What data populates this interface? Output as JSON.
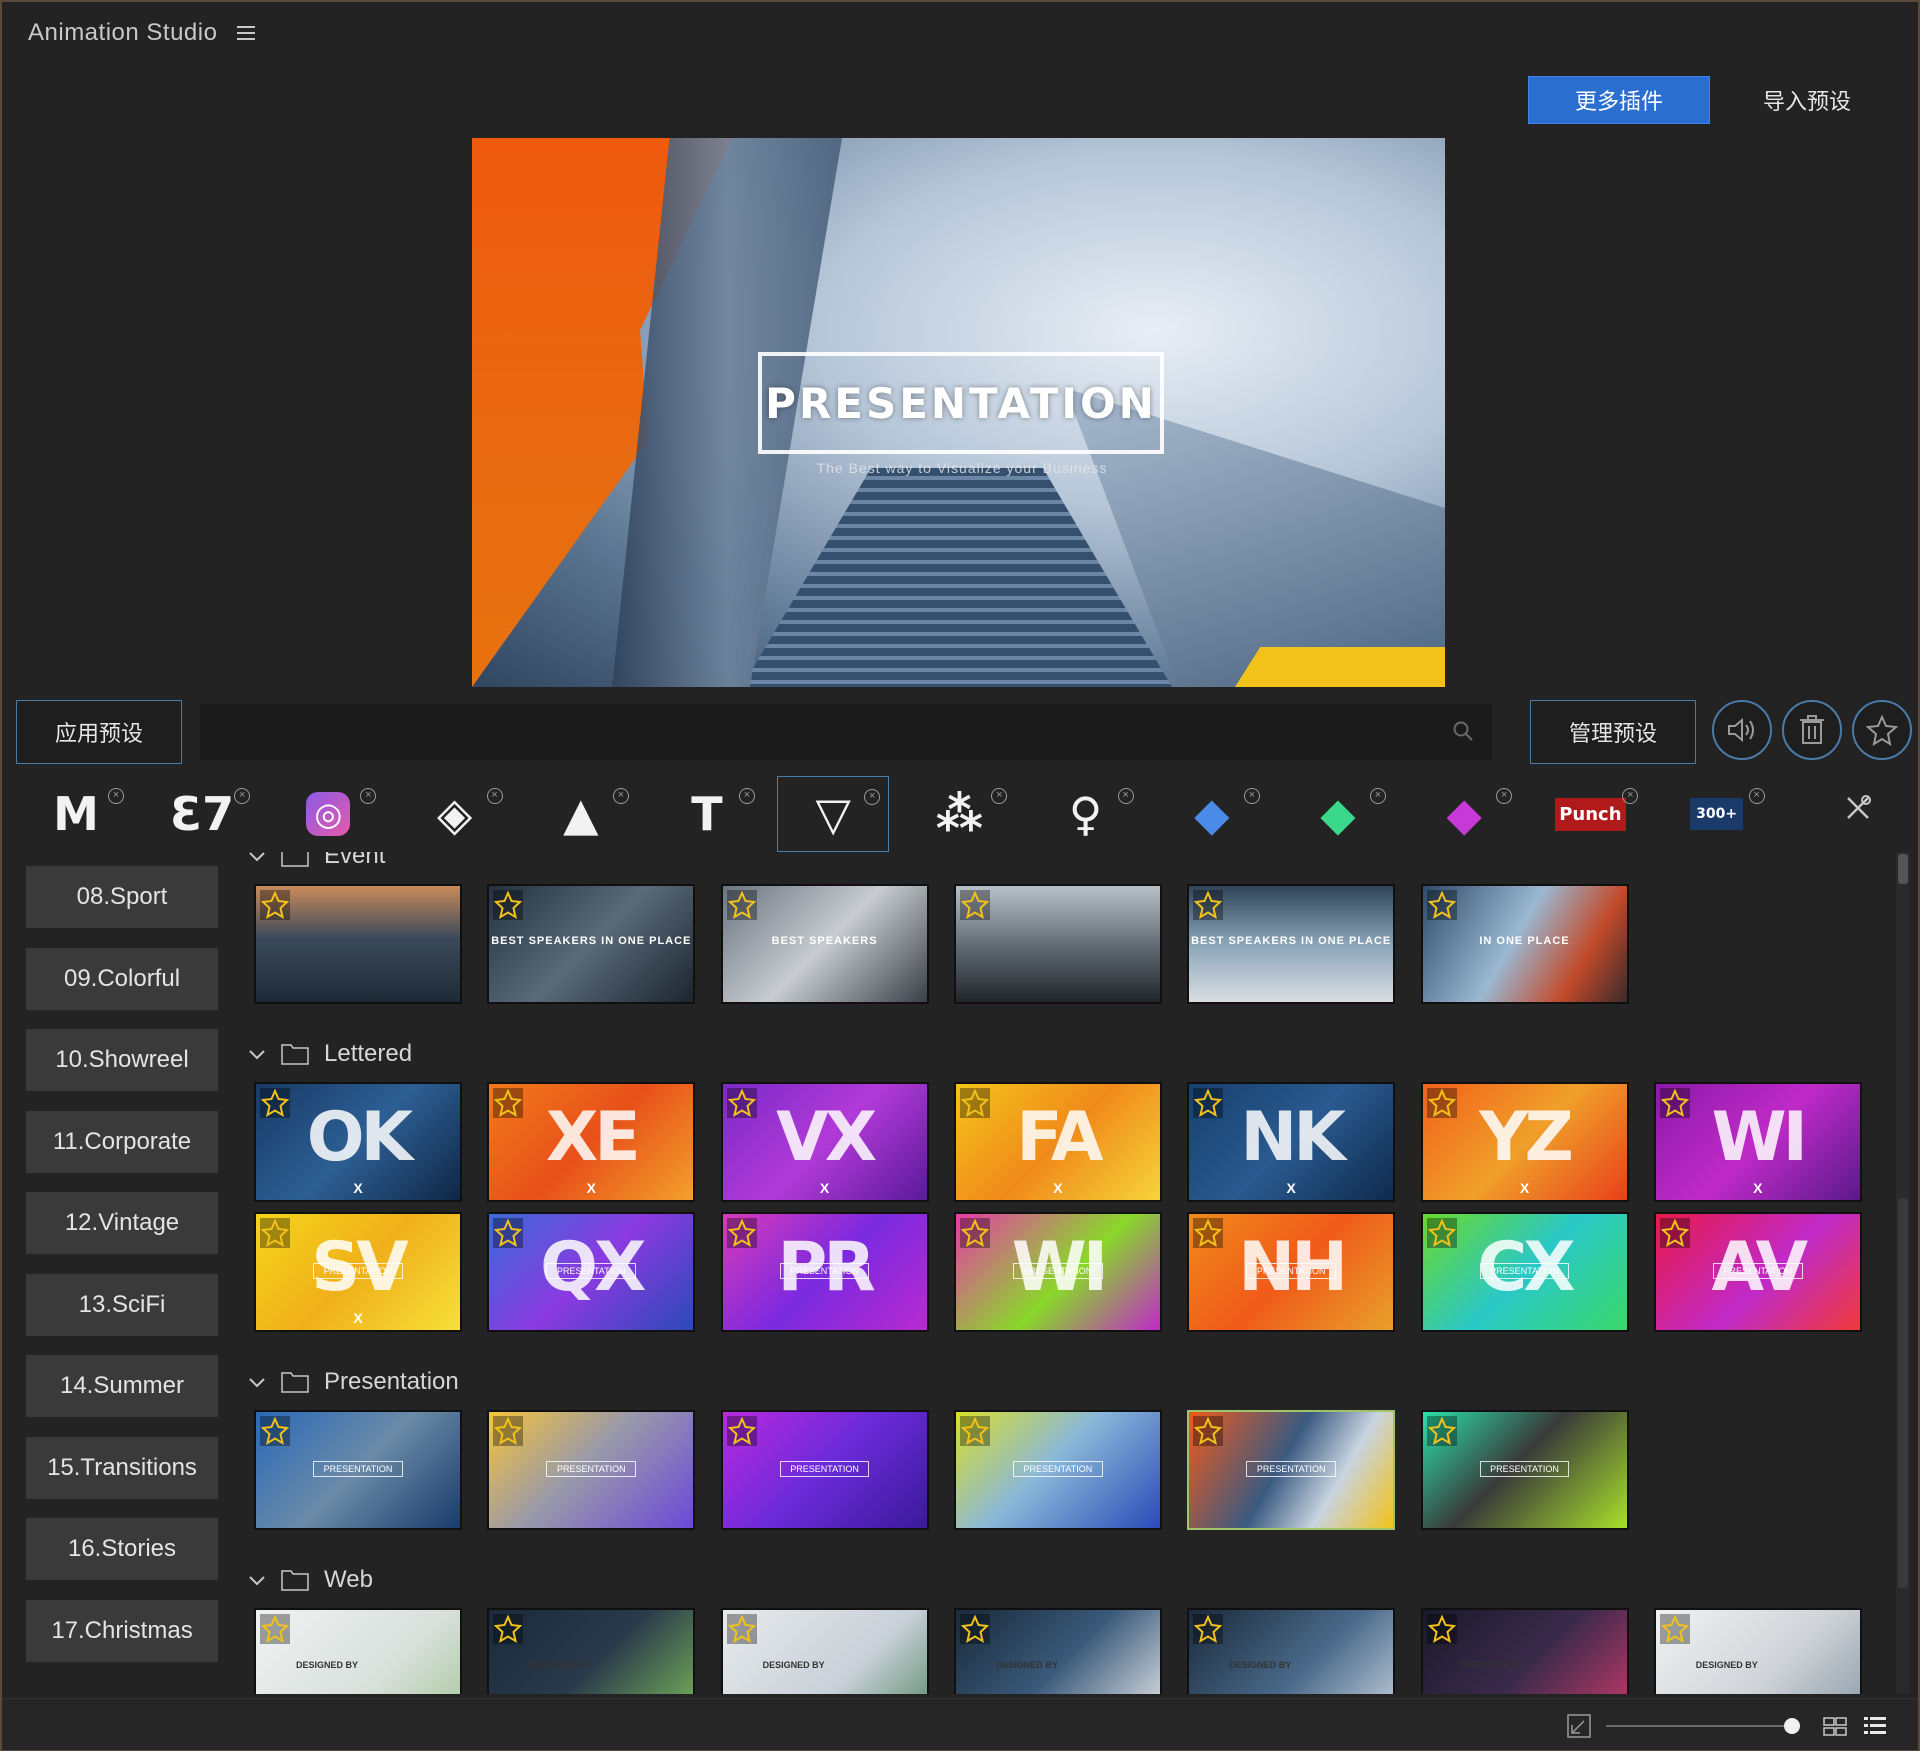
{
  "app": {
    "title": "Animation Studio"
  },
  "header": {
    "more_plugins": "更多插件",
    "import_presets": "导入预设"
  },
  "preview": {
    "title": "PRESENTATION",
    "subtitle": "The Best way to Visualize your Business"
  },
  "toolbar": {
    "apply_label": "应用预设",
    "manage_label": "管理预设",
    "search_value": "",
    "search_placeholder": ""
  },
  "plugins": [
    {
      "icon": "m-logo-icon",
      "glyph": "M",
      "style": "white"
    },
    {
      "icon": "e7-logo-icon",
      "glyph": "Ɛ7",
      "style": "white"
    },
    {
      "icon": "instagram-logo-icon",
      "glyph": "◎",
      "style": "insta"
    },
    {
      "icon": "layers-logo-icon",
      "glyph": "◈",
      "style": "white"
    },
    {
      "icon": "a-logo-icon",
      "glyph": "▲",
      "style": "white"
    },
    {
      "icon": "t-logo-icon",
      "glyph": "T",
      "style": "white"
    },
    {
      "icon": "v-logo-icon",
      "glyph": "▽",
      "style": "white",
      "active": true
    },
    {
      "icon": "molecule-logo-icon",
      "glyph": "⁂",
      "style": "white"
    },
    {
      "icon": "q-logo-icon",
      "glyph": "♀",
      "style": "white"
    },
    {
      "icon": "blue-cube-logo-icon",
      "glyph": "◆",
      "style": "blue"
    },
    {
      "icon": "green-cube-logo-icon",
      "glyph": "◆",
      "style": "green"
    },
    {
      "icon": "pink-cube-logo-icon",
      "glyph": "◆",
      "style": "pink"
    },
    {
      "icon": "punch-logo-icon",
      "glyph": "Punch",
      "style": "punch"
    },
    {
      "icon": "300-transitions-logo-icon",
      "glyph": "300+",
      "style": "t300"
    }
  ],
  "categories": [
    "08.Sport",
    "09.Colorful",
    "10.Showreel",
    "11.Corporate",
    "12.Vintage",
    "13.SciFi",
    "14.Summer",
    "15.Transitions",
    "16.Stories",
    "17.Christmas"
  ],
  "groups": [
    {
      "name": "Event",
      "items": [
        {
          "title": "",
          "bg": "linear-gradient(180deg,#c98a5a,#3b4a5a 45%,#1e2a36)"
        },
        {
          "title": "BEST SPEAKERS IN ONE PLACE",
          "bg": "linear-gradient(135deg,#243240,#5a6a78 50%,#1b2530)"
        },
        {
          "title": "BEST SPEAKERS",
          "bg": "linear-gradient(135deg,#6a7480,#c8ccd0 50%,#3a4048)"
        },
        {
          "title": "",
          "bg": "linear-gradient(180deg,#b9c1c8,#5d666e 55%,#20262c)"
        },
        {
          "title": "BEST SPEAKERS IN ONE PLACE",
          "bg": "linear-gradient(180deg,#2f4458,#8aa4b8 50%,#d9dee2)"
        },
        {
          "title": "IN ONE PLACE",
          "bg": "linear-gradient(120deg,#2e4c6a,#9ab8d2 45%,#c24a2a 75%,#3a2a2a)"
        }
      ]
    },
    {
      "name": "Lettered",
      "items": [
        {
          "big": "OK",
          "bg": "linear-gradient(135deg,#173a66,#2d5f94 50%,#0f2746)",
          "x": "X"
        },
        {
          "big": "XE",
          "bg": "linear-gradient(135deg,#f07a1a,#e8501a 50%,#f2a02a)",
          "x": "X"
        },
        {
          "big": "VX",
          "bg": "linear-gradient(135deg,#7a2ac8,#b23ad8 50%,#5a1a9a)",
          "x": "X"
        },
        {
          "big": "FA",
          "bg": "linear-gradient(135deg,#f4c41a,#f08a1a 50%,#f6d43a)",
          "x": "X"
        },
        {
          "big": "NK",
          "bg": "linear-gradient(135deg,#17406e,#2a5a90 50%,#0f2a4c)",
          "x": "X"
        },
        {
          "big": "YZ",
          "bg": "linear-gradient(135deg,#f2601a,#f0a02a 50%,#e8401a)",
          "x": "X"
        },
        {
          "big": "WI",
          "bg": "linear-gradient(135deg,#8a1aa8,#c02ac8 50%,#5a1a8a)",
          "x": "X"
        },
        {
          "big": "SV",
          "bg": "linear-gradient(135deg,#f4d41a,#f0b01a 50%,#f6e03a)",
          "x": "X",
          "pres": "PRESENTATION"
        },
        {
          "big": "QX",
          "bg": "linear-gradient(135deg,#3a6ad8,#8a3ae0 50%,#2a4ab8)",
          "pres": "PRESENTATION"
        },
        {
          "big": "PR",
          "bg": "linear-gradient(135deg,#d83ab8,#7a2ae0 50%,#b82ad0)",
          "pres": "PRESENTATION"
        },
        {
          "big": "WI",
          "bg": "linear-gradient(135deg,#e83aa8,#8ad82a 55%,#c02ac8)",
          "pres": "PRESENTATION"
        },
        {
          "big": "NH",
          "bg": "linear-gradient(135deg,#f08a1a,#f05a1a 50%,#e8a02a)",
          "pres": "PRESENTATION"
        },
        {
          "big": "CX",
          "bg": "linear-gradient(135deg,#6ad82a,#2ac8c8 50%,#3ad86a)",
          "pres": "PRESENTATION"
        },
        {
          "big": "AV",
          "bg": "linear-gradient(135deg,#e81a4a,#c02ac8 55%,#f03a3a)",
          "pres": "PRESENTATION"
        }
      ]
    },
    {
      "name": "Presentation",
      "items": [
        {
          "pres": "PRESENTATION",
          "bg": "linear-gradient(135deg,#2a6ab8,#6a8aa8 50%,#1a3a6a)"
        },
        {
          "pres": "PRESENTATION",
          "bg": "linear-gradient(135deg,#f4c43a,#9a9aa8 45%,#6a4ad8)"
        },
        {
          "pres": "PRESENTATION",
          "bg": "linear-gradient(135deg,#b82ae0,#6a2ad8 50%,#3a1a9a)"
        },
        {
          "pres": "PRESENTATION",
          "bg": "linear-gradient(135deg,#d8e02a,#8ab8d8 45%,#2a4ab8)"
        },
        {
          "pres": "PRESENTATION",
          "bg": "linear-gradient(120deg,#f05a1a,#3a5a80 45%,#c8d4e0 70%,#f2c21a)",
          "selected": true
        },
        {
          "pres": "PRESENTATION",
          "bg": "linear-gradient(135deg,#2ae0a8,#3a3a3a 45%,#a8e02a)"
        }
      ]
    },
    {
      "name": "Web",
      "items": [
        {
          "designed": "DESIGNED BY",
          "bg": "linear-gradient(135deg,#f0f2f2,#d8e0dc 60%,#a8c89a)"
        },
        {
          "designed": "DESIGNED BY",
          "bg": "linear-gradient(135deg,#1a2a3a,#2a3a4a 50%,#7ab85a)"
        },
        {
          "designed": "DESIGNED BY",
          "bg": "linear-gradient(135deg,#e8eaec,#c8d0d8 60%,#5a8a6a)"
        },
        {
          "designed": "DESIGNED BY",
          "bg": "linear-gradient(135deg,#1a2a3a,#3a5a7a 50%,#e8eaec)"
        },
        {
          "designed": "DESIGNED BY",
          "bg": "linear-gradient(135deg,#1a2a3a,#4a6a8a 55%,#c8d4e0)"
        },
        {
          "designed": "DESIGNED BY",
          "bg": "linear-gradient(135deg,#1a1a2a,#3a2a4a 50%,#c83a6a)"
        },
        {
          "designed": "DESIGNED BY",
          "bg": "linear-gradient(135deg,#f0f2f2,#d0d4d8 55%,#8a9aa8)"
        }
      ]
    }
  ],
  "colors": {
    "accent": "#2a6fd0",
    "border_accent": "#4a7aa8",
    "star": "#f2c21a",
    "background": "#232323"
  },
  "view": {
    "zoom_fraction": 0.98
  }
}
